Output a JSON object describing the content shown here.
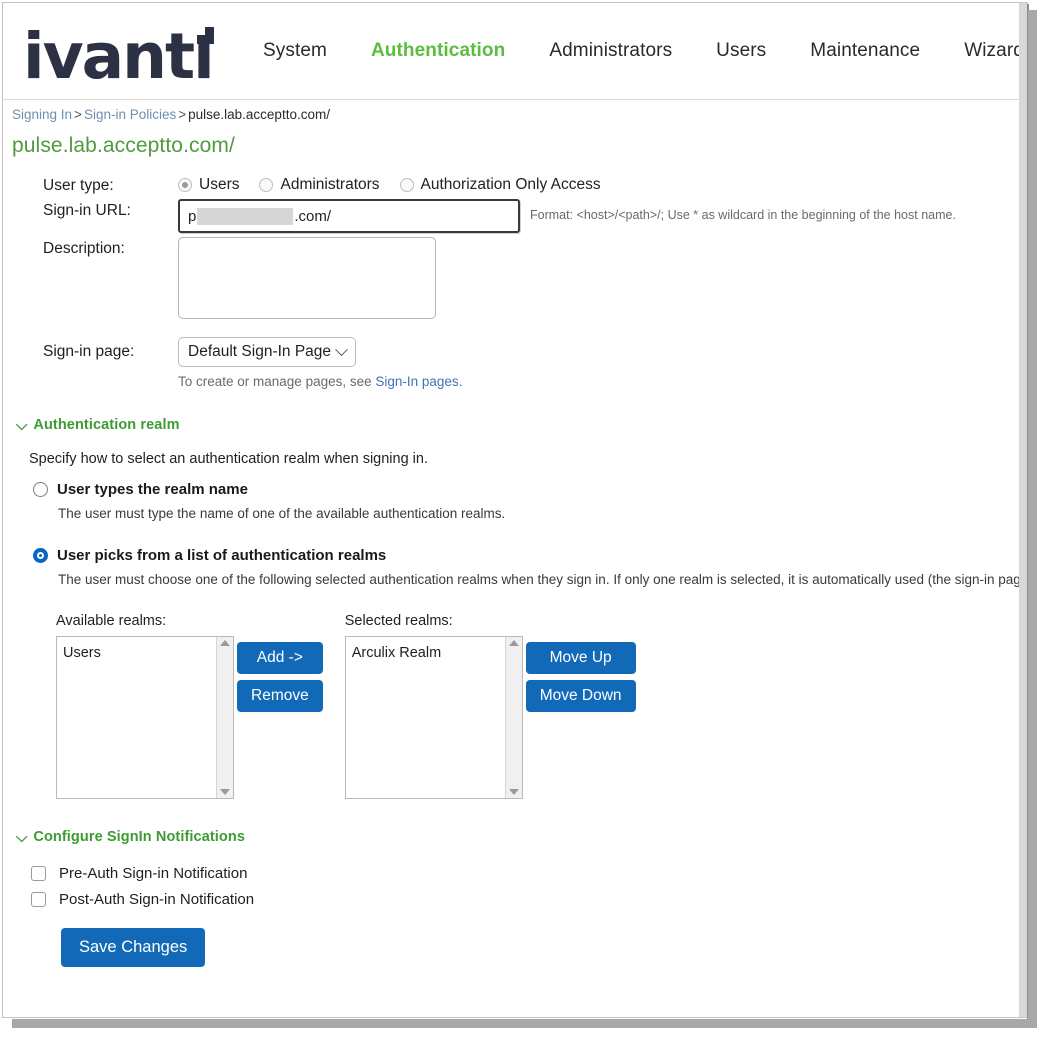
{
  "brand": {
    "logo_text": "ivanti",
    "accent_green": "#5bbd3f",
    "logo_color": "#2c3143",
    "button_blue": "#1269b8",
    "link_blue": "#3f74b3",
    "section_green": "#3d9b33",
    "title_green": "#4e9c3e"
  },
  "nav": {
    "items": [
      {
        "label": "System",
        "active": false
      },
      {
        "label": "Authentication",
        "active": true
      },
      {
        "label": "Administrators",
        "active": false
      },
      {
        "label": "Users",
        "active": false
      },
      {
        "label": "Maintenance",
        "active": false
      },
      {
        "label": "Wizards",
        "active": false
      }
    ]
  },
  "breadcrumb": {
    "item1": "Signing In",
    "sep1": ">",
    "item2": "Sign-in Policies",
    "sep2": ">",
    "current": "pulse.lab.acceptto.com/"
  },
  "page_title": "pulse.lab.acceptto.com/",
  "form": {
    "user_type_label": "User type:",
    "user_type_options": [
      {
        "label": "Users",
        "selected": true
      },
      {
        "label": "Administrators",
        "selected": false
      },
      {
        "label": "Authorization Only Access",
        "selected": false
      }
    ],
    "signin_url_label": "Sign-in URL:",
    "signin_url_prefix": "p",
    "signin_url_redacted": true,
    "signin_url_suffix": ".com/",
    "signin_url_format_hint": "Format: <host>/<path>/;   Use * as wildcard in the beginning of the host name.",
    "description_label": "Description:",
    "description_value": "",
    "signin_page_label": "Sign-in page:",
    "signin_page_value": "Default Sign-In Page",
    "signin_page_note_prefix": "To create or manage pages, see ",
    "signin_page_note_link": "Sign-In pages",
    "signin_page_note_suffix": "."
  },
  "realm_section": {
    "header": "Authentication realm",
    "chevron": "⌵",
    "intro": "Specify how to select an authentication realm when signing in.",
    "option_type": {
      "label": "User types the realm name",
      "selected": false,
      "description": "The user must type the name of one of the available authentication realms."
    },
    "option_pick": {
      "label": "User picks from a list of authentication realms",
      "selected": true,
      "description": "The user must choose one of the following selected authentication realms when they sign in. If only one realm is selected, it is automatically used (the sign-in page will n"
    },
    "available_caption": "Available realms:",
    "available_items": [
      "Users"
    ],
    "selected_caption": "Selected realms:",
    "selected_items": [
      "Arculix Realm"
    ],
    "add_button": "Add ->",
    "remove_button": "Remove",
    "move_up_button": "Move Up",
    "move_down_button": "Move Down"
  },
  "notifications_section": {
    "header": "Configure SignIn Notifications",
    "chevron": "⌵",
    "pre_auth_label": "Pre-Auth Sign-in Notification",
    "pre_auth_checked": false,
    "post_auth_label": "Post-Auth Sign-in Notification",
    "post_auth_checked": false
  },
  "save_button": "Save Changes"
}
